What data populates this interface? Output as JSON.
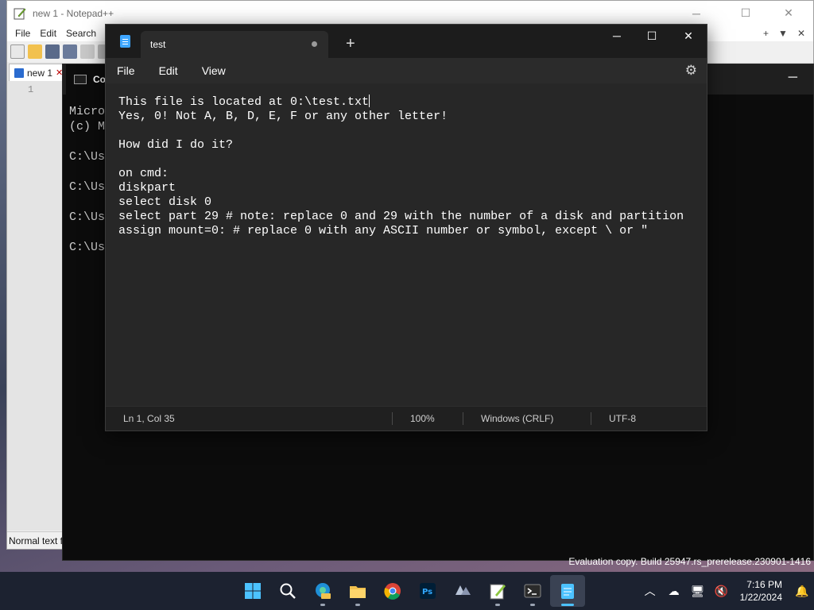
{
  "notepadpp": {
    "title": "new 1 - Notepad++",
    "menu": [
      "File",
      "Edit",
      "Search"
    ],
    "menu_right": [
      "+",
      "▼",
      "✕"
    ],
    "tab_label": "new 1",
    "tab_close": "✕",
    "line_number": "1",
    "status_text": "Normal text f",
    "caption": {
      "minimize": "─",
      "maximize": "☐",
      "close": "✕"
    },
    "icons": [
      "new-file-icon",
      "open-file-icon",
      "save-icon",
      "save-all-icon",
      "close-icon",
      "close-all-icon",
      "print-icon"
    ]
  },
  "cmd": {
    "tab_title": "Co",
    "minimize": "─",
    "lines": [
      "Micros",
      "(c) Mi",
      "",
      "C:\\Use",
      "",
      "C:\\Use",
      "",
      "C:\\Use",
      "",
      "C:\\Use"
    ]
  },
  "notepad": {
    "tab_title": "test",
    "new_tab": "+",
    "caption": {
      "minimize": "─",
      "maximize": "☐",
      "close": "✕"
    },
    "menu": {
      "file": "File",
      "edit": "Edit",
      "view": "View"
    },
    "settings_icon": "gear-icon",
    "lines": [
      "This file is located at 0:\\test.txt",
      "Yes, 0! Not A, B, D, E, F or any other letter!",
      "",
      "How did I do it?",
      "",
      "on cmd:",
      "diskpart",
      "select disk 0",
      "select part 29 # note: replace 0 and 29 with the number of a disk and partition",
      "assign mount=0: # replace 0 with any ASCII number or symbol, except \\ or \""
    ],
    "status": {
      "position": "Ln 1, Col 35",
      "zoom": "100%",
      "line_ending": "Windows (CRLF)",
      "encoding": "UTF-8"
    },
    "colors": {
      "background": "#272727",
      "text": "#ffffff"
    }
  },
  "watermark": "Evaluation copy. Build 25947.rs_prerelease.230901-1416",
  "taskbar": {
    "apps": [
      {
        "name": "start-button",
        "color": "#4cc2ff"
      },
      {
        "name": "search-button",
        "color": "#ffffff"
      },
      {
        "name": "edge-pre-icon",
        "color": "#1f8fd6"
      },
      {
        "name": "file-explorer-icon",
        "color": "#f2c14e"
      },
      {
        "name": "chrome-icon",
        "color": "#db4437"
      },
      {
        "name": "photoshop-icon",
        "color": "#31a8ff"
      },
      {
        "name": "math-app-icon",
        "color": "#b8c4d8"
      },
      {
        "name": "notepadpp-taskbar-icon",
        "color": "#8dc63f"
      },
      {
        "name": "terminal-icon",
        "color": "#2b2b2b"
      },
      {
        "name": "notepad-taskbar-icon",
        "color": "#4cc2ff"
      }
    ],
    "tray": {
      "chevron": "︿",
      "onedrive": "☁",
      "network": "🖥",
      "volume": "🔇"
    },
    "time": "7:16 PM",
    "date": "1/22/2024",
    "notifications": "🔔"
  }
}
